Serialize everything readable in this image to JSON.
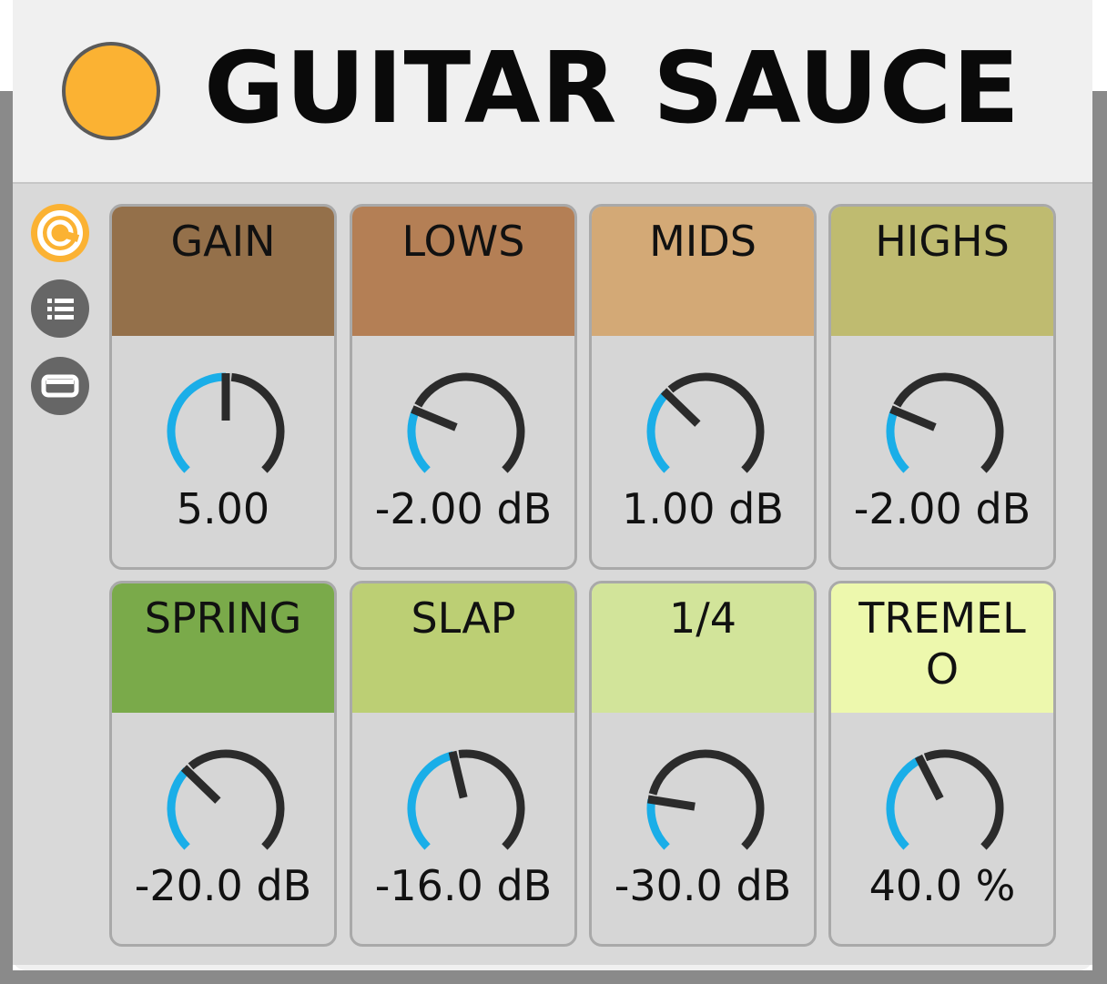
{
  "device": {
    "title": "GUITAR SAUCE",
    "power_color": "#fbb233"
  },
  "sidebar": {
    "buttons": [
      {
        "icon": "hot-swap-icon",
        "active": true
      },
      {
        "icon": "list-icon",
        "active": false
      },
      {
        "icon": "collapse-icon",
        "active": false
      }
    ]
  },
  "macros": [
    {
      "label": "GAIN",
      "value": "5.00",
      "level": 0.5,
      "color": "#94704a"
    },
    {
      "label": "LOWS",
      "value": "-2.00 dB",
      "level": 0.25,
      "color": "#b47f55"
    },
    {
      "label": "MIDS",
      "value": "1.00 dB",
      "level": 0.33,
      "color": "#d3a976"
    },
    {
      "label": "HIGHS",
      "value": "-2.00 dB",
      "level": 0.25,
      "color": "#bfbb70"
    },
    {
      "label": "SPRING",
      "value": "-20.0 dB",
      "level": 0.33,
      "color": "#7aaa4a"
    },
    {
      "label": "SLAP",
      "value": "-16.0 dB",
      "level": 0.45,
      "color": "#bccf74"
    },
    {
      "label": "1/4",
      "value": "-30.0 dB",
      "level": 0.2,
      "color": "#d2e49a"
    },
    {
      "label": "TREMELO",
      "value": "40.0 %",
      "level": 0.4,
      "color": "#edf8ad"
    }
  ],
  "colors": {
    "knob_active": "#1aaee8",
    "knob_track": "#2b2b2b"
  }
}
